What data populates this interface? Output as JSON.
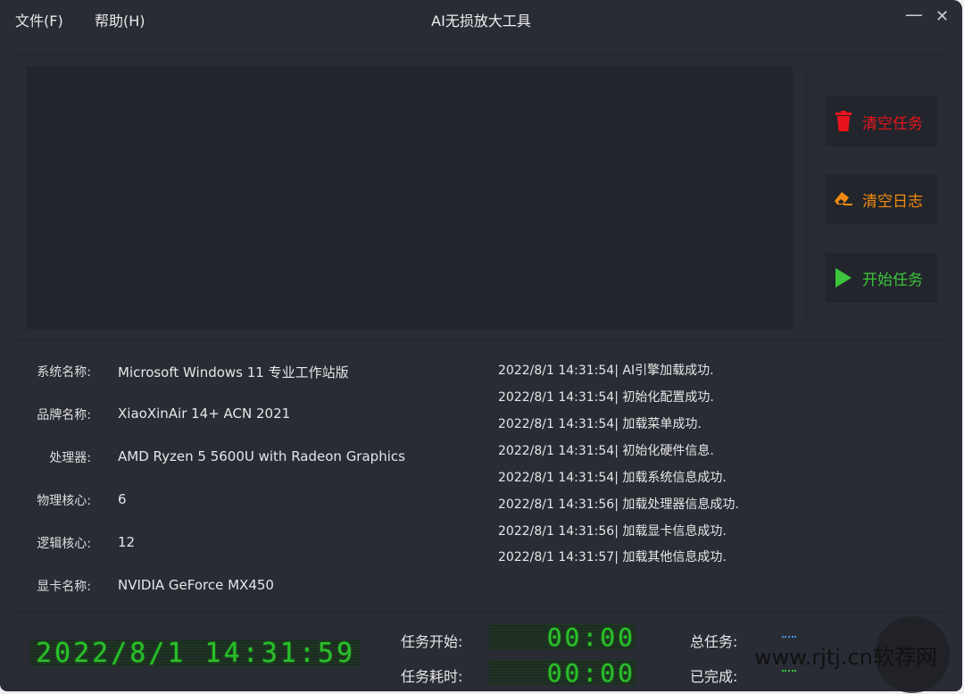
{
  "menu": {
    "file": "文件(F)",
    "help": "帮助(H)"
  },
  "window": {
    "title": "AI无损放大工具",
    "minimize": "—",
    "close": "✕"
  },
  "actions": [
    {
      "label": "清空任务",
      "icon": "trash-icon",
      "color": "#e8141c"
    },
    {
      "label": "清空日志",
      "icon": "eraser-icon",
      "color": "#f08a10"
    },
    {
      "label": "开始任务",
      "icon": "play-icon",
      "color": "#3cc43c"
    }
  ],
  "system_info": [
    {
      "key": "系统名称:",
      "value": "Microsoft Windows 11 专业工作站版"
    },
    {
      "key": "品牌名称:",
      "value": "XiaoXinAir 14+ ACN 2021"
    },
    {
      "key": "处理器:",
      "value": "AMD Ryzen 5 5600U with Radeon Graphics"
    },
    {
      "key": "物理核心:",
      "value": "6"
    },
    {
      "key": "逻辑核心:",
      "value": "12"
    },
    {
      "key": "显卡名称:",
      "value": "NVIDIA GeForce MX450"
    }
  ],
  "log": [
    "2022/8/1 14:31:54| AI引擎加载成功.",
    "2022/8/1 14:31:54| 初始化配置成功.",
    "2022/8/1 14:31:54| 加载菜单成功.",
    "2022/8/1 14:31:54| 初始化硬件信息.",
    "2022/8/1 14:31:54| 加载系统信息成功.",
    "2022/8/1 14:31:56| 加载处理器信息成功.",
    "2022/8/1 14:31:56| 加载显卡信息成功.",
    "2022/8/1 14:31:57| 加载其他信息成功."
  ],
  "status": {
    "clock": "2022/8/1 14:31:59",
    "task_start_label": "任务开始:",
    "task_start": "00:00",
    "task_elapsed_label": "任务耗时:",
    "task_elapsed": "00:00",
    "total_label": "总任务:",
    "done_label": "已完成:"
  },
  "watermark": "www.rjtj.cn软荐网"
}
